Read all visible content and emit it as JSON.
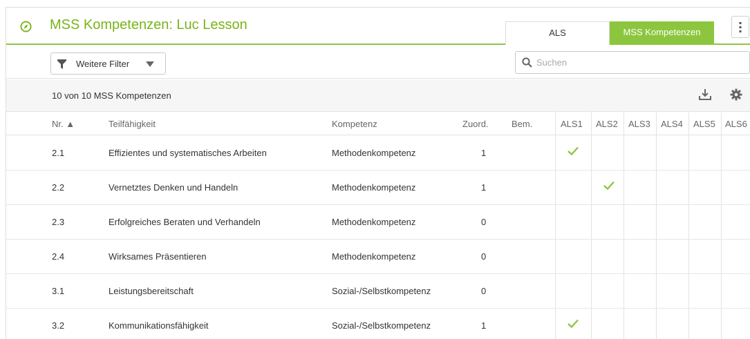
{
  "header": {
    "title": "MSS Kompetenzen: Luc Lesson",
    "title_icon": "compass-icon",
    "tabs": [
      {
        "label": "ALS",
        "active": false
      },
      {
        "label": "MSS Kompetenzen",
        "active": true
      }
    ],
    "menu_icon": "kebab-menu-icon"
  },
  "filter": {
    "label": "Weitere Filter",
    "search_placeholder": "Suchen",
    "search_value": ""
  },
  "toolbar": {
    "count_text": "10 von 10 MSS Kompetenzen",
    "download_icon": "download-icon",
    "settings_icon": "gear-icon"
  },
  "table": {
    "columns": {
      "nr": "Nr. ▲",
      "teil": "Teilfähigkeit",
      "komp": "Kompetenz",
      "zuord": "Zuord.",
      "bem": "Bem.",
      "als": [
        "ALS1",
        "ALS2",
        "ALS3",
        "ALS4",
        "ALS5",
        "ALS6"
      ]
    },
    "rows": [
      {
        "nr": "2.1",
        "teil": "Effizientes und systematisches Arbeiten",
        "komp": "Methodenkompetenz",
        "zuord": "1",
        "bem": "",
        "checks": [
          true,
          false,
          false,
          false,
          false,
          false
        ]
      },
      {
        "nr": "2.2",
        "teil": "Vernetztes Denken und Handeln",
        "komp": "Methodenkompetenz",
        "zuord": "1",
        "bem": "",
        "checks": [
          false,
          true,
          false,
          false,
          false,
          false
        ]
      },
      {
        "nr": "2.3",
        "teil": "Erfolgreiches Beraten und Verhandeln",
        "komp": "Methodenkompetenz",
        "zuord": "0",
        "bem": "",
        "checks": [
          false,
          false,
          false,
          false,
          false,
          false
        ]
      },
      {
        "nr": "2.4",
        "teil": "Wirksames Präsentieren",
        "komp": "Methodenkompetenz",
        "zuord": "0",
        "bem": "",
        "checks": [
          false,
          false,
          false,
          false,
          false,
          false
        ]
      },
      {
        "nr": "3.1",
        "teil": "Leistungsbereitschaft",
        "komp": "Sozial-/Selbstkompetenz",
        "zuord": "0",
        "bem": "",
        "checks": [
          false,
          false,
          false,
          false,
          false,
          false
        ]
      },
      {
        "nr": "3.2",
        "teil": "Kommunikationsfähigkeit",
        "komp": "Sozial-/Selbstkompetenz",
        "zuord": "1",
        "bem": "",
        "checks": [
          true,
          false,
          false,
          false,
          false,
          false
        ]
      }
    ]
  },
  "colors": {
    "accent": "#8cc63f",
    "title": "#7ab317",
    "check": "#8cc63f"
  }
}
